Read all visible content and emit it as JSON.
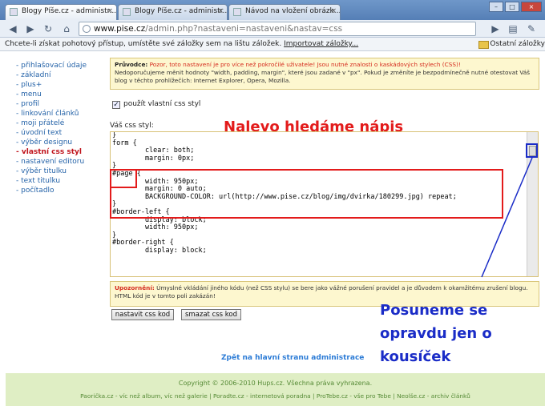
{
  "browser": {
    "tabs": [
      {
        "label": "Blogy Píše.cz - administr...",
        "active": true
      },
      {
        "label": "Blogy Píše.cz - administr...",
        "active": false
      },
      {
        "label": "Návod na vložení obrázk...",
        "active": false
      }
    ],
    "url_host": "www.pise.cz",
    "url_path": "/admin.php?nastaveni=nastaveni&nastav=css",
    "bookmarks_prompt": "Chcete-li získat pohotový přístup, umístěte své záložky sem na lištu záložek.",
    "bookmarks_import": "Importovat záložky...",
    "bookmarks_other": "Ostatní záložky"
  },
  "sidebar": {
    "items": [
      {
        "label": "přihlašovací údaje"
      },
      {
        "label": "základní"
      },
      {
        "label": "plus+"
      },
      {
        "label": "menu"
      },
      {
        "label": "profil"
      },
      {
        "label": "linkování článků"
      },
      {
        "label": "moji přátelé"
      },
      {
        "label": "úvodní text"
      },
      {
        "label": "výběr designu"
      },
      {
        "label": "vlastní css styl",
        "active": true
      },
      {
        "label": "nastavení editoru"
      },
      {
        "label": "výběr titulku"
      },
      {
        "label": "text titulku"
      },
      {
        "label": "počítadlo"
      }
    ]
  },
  "info": {
    "title": "Průvodce:",
    "warning": "Pozor, toto nastavení je pro více než pokročilé uživatele! Jsou nutné znalosti o kaskádových stylech (CSS)!",
    "text": "Nedoporučujeme měnit hodnoty \"width, padding, margin\", které jsou zadané v \"px\". Pokud je změníte je bezpodmínečně nutné otestovat Váš blog v těchto prohlížečích: Internet Explorer, Opera, Mozilla."
  },
  "form": {
    "checkbox_label": "použít vlastní css styl",
    "checked": true,
    "css_label": "Váš css styl:",
    "code": "}\nform {\n        clear: both;\n        margin: 0px;\n}\n#page {\n        width: 950px;\n        margin: 0 auto;\n        BACKGROUND-COLOR: url(http://www.pise.cz/blog/img/dvirka/180299.jpg) repeat;\n}\n#border-left {\n        display: block;\n        width: 950px;\n}\n#border-right {\n        display: block;",
    "warn_title": "Upozornění:",
    "warn_text": "Úmyslné vkládání jiného kódu (než CSS stylu) se bere jako vážné porušení pravidel a je důvodem k okamžitému zrušení blogu. HTML kód je v tomto poli zakázán!",
    "save_button": "nastavit css kod",
    "delete_button": "smazat css kod"
  },
  "annotations": {
    "left_text": "Nalevo hledáme nápis #page",
    "right_text": "Posuneme se opravdu jen o kousíček"
  },
  "back_link": "Zpět na hlavní stranu administrace",
  "footer": {
    "copyright": "Copyright © 2006-2010 Hups.cz. Všechna práva vyhrazena.",
    "links": "Paorička.cz - víc než album, víc než galerie | Poradte.cz - internetová poradna | ProTebe.cz - vše pro Tebe | Neolše.cz - archiv článků"
  },
  "colors": {
    "annotation_red": "#e31b1b",
    "annotation_blue": "#1a2cc7",
    "link_blue": "#2563a8",
    "footer_bg": "#dfeec4"
  }
}
